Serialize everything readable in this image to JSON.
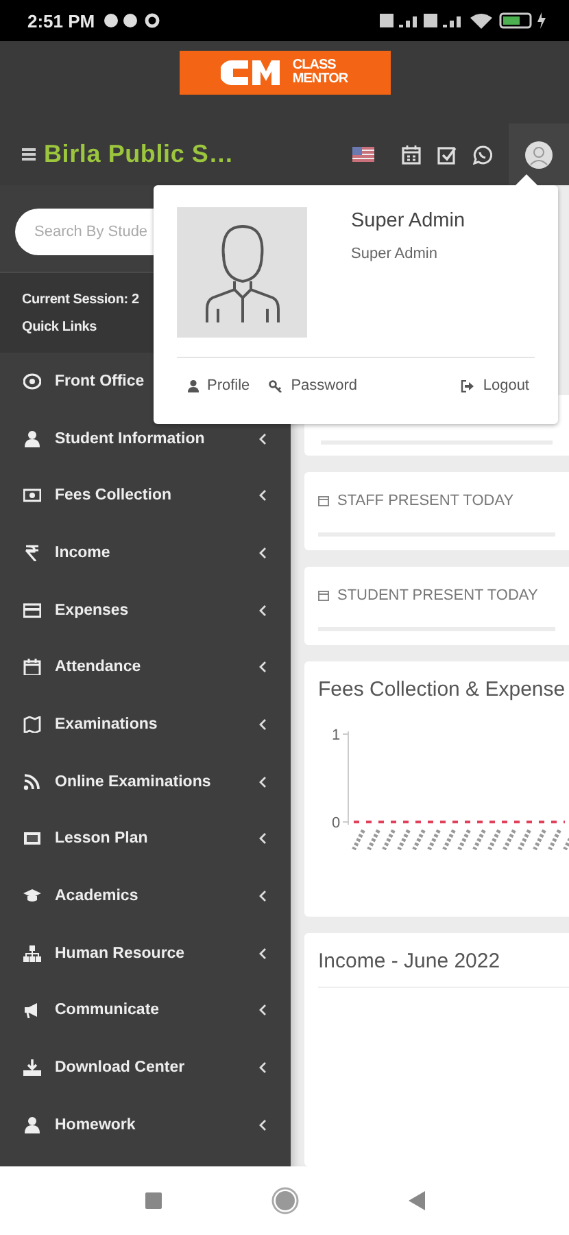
{
  "status_bar": {
    "time": "2:51 PM"
  },
  "logo": {
    "line_1": "CLASS",
    "line_2": "MENTOR"
  },
  "navbar": {
    "title": "Birla Public S…"
  },
  "sidebar": {
    "search": {
      "placeholder": "Search By Stude"
    },
    "session": "Current Session: 2",
    "quick_links": "Quick Links",
    "items": [
      {
        "label": "Front Office",
        "arrow": false
      },
      {
        "label": "Student Information",
        "arrow": true
      },
      {
        "label": "Fees Collection",
        "arrow": true
      },
      {
        "label": "Income",
        "arrow": true
      },
      {
        "label": "Expenses",
        "arrow": true
      },
      {
        "label": "Attendance",
        "arrow": true
      },
      {
        "label": "Examinations",
        "arrow": true
      },
      {
        "label": "Online Examinations",
        "arrow": true
      },
      {
        "label": "Lesson Plan",
        "arrow": true
      },
      {
        "label": "Academics",
        "arrow": true
      },
      {
        "label": "Human Resource",
        "arrow": true
      },
      {
        "label": "Communicate",
        "arrow": true
      },
      {
        "label": "Download Center",
        "arrow": true
      },
      {
        "label": "Homework",
        "arrow": true
      }
    ]
  },
  "cards": [
    {
      "title": "STAFF PRESENT TODAY"
    },
    {
      "title": "STUDENT PRESENT TODAY"
    }
  ],
  "fees_chart": {
    "title": "Fees Collection & Expense",
    "chart_data": {
      "type": "line",
      "ylim": [
        0,
        1
      ],
      "yticks": [
        0,
        1
      ],
      "series": [
        {
          "color": "#e0405a",
          "line_style": "dashed",
          "values": [
            0,
            0,
            0,
            0,
            0,
            0,
            0,
            0,
            0,
            0,
            0,
            0,
            0,
            0,
            0
          ]
        }
      ]
    }
  },
  "income": {
    "title": "Income - June 2022"
  },
  "profile_menu": {
    "name": "Super Admin",
    "role": "Super Admin",
    "links": [
      {
        "label": "Profile"
      },
      {
        "label": "Password"
      },
      {
        "label": "Logout"
      }
    ]
  }
}
